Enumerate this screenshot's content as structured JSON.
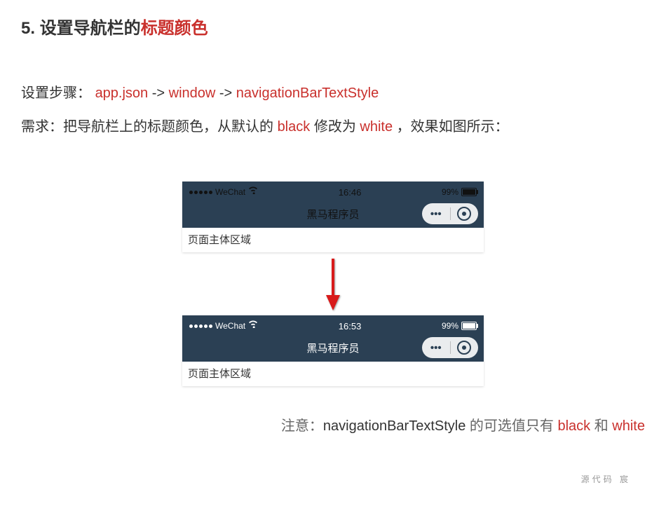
{
  "heading": {
    "num": "5. ",
    "pre": "设置导航栏的",
    "red": "标题颜色"
  },
  "step": {
    "label": "设置步骤：",
    "p1": "app.json",
    "arrow1": " -> ",
    "p2": "window",
    "arrow2": " -> ",
    "p3": "navigationBarTextStyle"
  },
  "req": {
    "pre": "需求：把导航栏上的标题颜色，从默认的 ",
    "w1": "black",
    "mid": " 修改为 ",
    "w2": "white",
    "post": " ，效果如图所示："
  },
  "mock": {
    "carrier": "WeChat",
    "wifi": "⌂",
    "time_before": "16:46",
    "time_after": "16:53",
    "battery": "99%",
    "nav_title": "黑马程序员",
    "body_text": "页面主体区域",
    "dots": "•••"
  },
  "note": {
    "label": "注意：",
    "key": "navigationBarTextStyle",
    "mid": " 的可选值只有 ",
    "w1": "black",
    "and": " 和 ",
    "w2": "white"
  },
  "watermark": "源代码  宸"
}
